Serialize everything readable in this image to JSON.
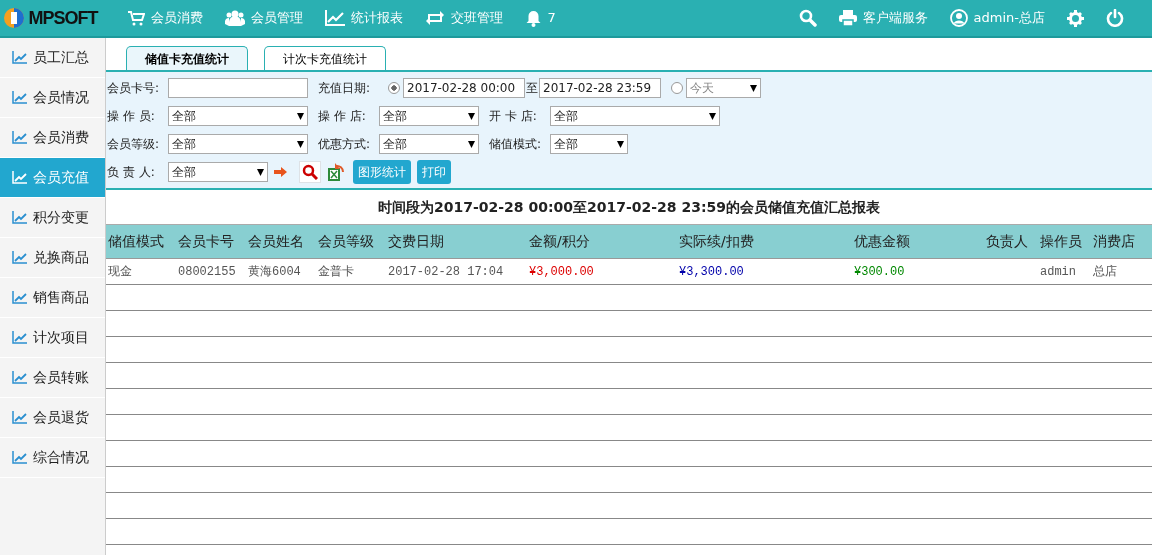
{
  "brand": {
    "logo": "MPSOFT"
  },
  "nav": [
    {
      "kind": "cart",
      "label": "会员消费"
    },
    {
      "kind": "users",
      "label": "会员管理"
    },
    {
      "kind": "chart",
      "label": "统计报表"
    },
    {
      "kind": "swap",
      "label": "交班管理"
    },
    {
      "kind": "bell",
      "label": "7"
    }
  ],
  "nav_right": [
    {
      "kind": "search"
    },
    {
      "kind": "print",
      "label": "客户端服务"
    },
    {
      "kind": "user",
      "label": "admin-总店"
    },
    {
      "kind": "gear"
    },
    {
      "kind": "power"
    }
  ],
  "sidebar": {
    "items": [
      {
        "label": "员工汇总",
        "selected": false
      },
      {
        "label": "会员情况",
        "selected": false
      },
      {
        "label": "会员消费",
        "selected": false
      },
      {
        "label": "会员充值",
        "selected": true
      },
      {
        "label": "积分变更",
        "selected": false
      },
      {
        "label": "兑换商品",
        "selected": false
      },
      {
        "label": "销售商品",
        "selected": false
      },
      {
        "label": "计次项目",
        "selected": false
      },
      {
        "label": "会员转账",
        "selected": false
      },
      {
        "label": "会员退货",
        "selected": false
      },
      {
        "label": "综合情况",
        "selected": false
      }
    ]
  },
  "tabs": [
    {
      "label": "储值卡充值统计",
      "selected": true
    },
    {
      "label": "计次卡充值统计",
      "selected": false
    }
  ],
  "filters": [
    [
      {
        "kind": "text",
        "label": "会员卡号:"
      },
      {
        "kind": "daterange",
        "label": "充值日期:",
        "selected": true,
        "from": "2017-02-28 00:00",
        "sep": "至",
        "to": "2017-02-28 23:59"
      },
      {
        "kind": "preset",
        "selected": false,
        "value": "今天"
      }
    ],
    [
      {
        "kind": "select",
        "label": "操 作 员:",
        "value": "全部"
      },
      {
        "kind": "select",
        "label": "操 作 店:",
        "value": "全部"
      },
      {
        "kind": "select",
        "label": "开 卡 店:",
        "value": "全部"
      }
    ],
    [
      {
        "kind": "select",
        "label": "会员等级:",
        "value": "全部"
      },
      {
        "kind": "select",
        "label": "优惠方式:",
        "value": "全部"
      },
      {
        "kind": "select",
        "label": "储值模式:",
        "value": "全部"
      }
    ],
    [
      {
        "kind": "select",
        "label": "负 责 人:",
        "value": "全部"
      },
      {
        "kind": "arrow"
      },
      {
        "kind": "search"
      },
      {
        "kind": "excel"
      },
      {
        "kind": "button",
        "label": "图形统计"
      },
      {
        "kind": "button",
        "label": "打印"
      }
    ]
  ],
  "report": {
    "title": "时间段为2017-02-28 00:00至2017-02-28 23:59的会员储值充值汇总报表",
    "columns": [
      "储值模式",
      "会员卡号",
      "会员姓名",
      "会员等级",
      "交费日期",
      "金额/积分",
      "实际续/扣费",
      "优惠金额",
      "负责人",
      "操作员",
      "消费店"
    ],
    "rows": [
      [
        "现金",
        "08002155",
        "黄海6004",
        "金普卡",
        "2017-02-28 17:04",
        "¥3,000.00",
        "¥3,300.00",
        "¥300.00",
        "",
        "admin",
        "总店"
      ]
    ]
  }
}
